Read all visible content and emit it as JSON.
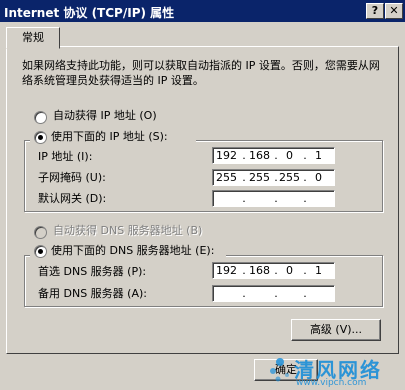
{
  "window": {
    "title": "Internet 协议 (TCP/IP) 属性",
    "help_button": "?",
    "close_button": "✕"
  },
  "tabs": [
    {
      "label": "常规"
    }
  ],
  "description": "如果网络支持此功能，则可以获取自动指派的 IP 设置。否则，您需要从网络系统管理员处获得适当的 IP 设置。",
  "ip_section": {
    "auto_option": "自动获得 IP 地址 (O)",
    "manual_option": "使用下面的 IP 地址 (S):",
    "fields": [
      {
        "label": "IP 地址 (I):",
        "octets": [
          "192",
          "168",
          "0",
          "1"
        ]
      },
      {
        "label": "子网掩码 (U):",
        "octets": [
          "255",
          "255",
          "255",
          "0"
        ]
      },
      {
        "label": "默认网关 (D):",
        "octets": [
          "",
          "",
          "",
          ""
        ]
      }
    ]
  },
  "dns_section": {
    "auto_option": "自动获得 DNS 服务器地址 (B)",
    "manual_option": "使用下面的 DNS 服务器地址 (E):",
    "fields": [
      {
        "label": "首选 DNS 服务器 (P):",
        "octets": [
          "192",
          "168",
          "0",
          "1"
        ]
      },
      {
        "label": "备用 DNS 服务器 (A):",
        "octets": [
          "",
          "",
          "",
          ""
        ]
      }
    ]
  },
  "advanced_button": "高级 (V)...",
  "ok_button": "确定",
  "watermark": {
    "brand": "清风网络",
    "url": "www.vipcn.com"
  },
  "colors": {
    "titlebar": "#0a246a",
    "face": "#d4d0c8",
    "watermark_blue": "#1e8fd8"
  }
}
